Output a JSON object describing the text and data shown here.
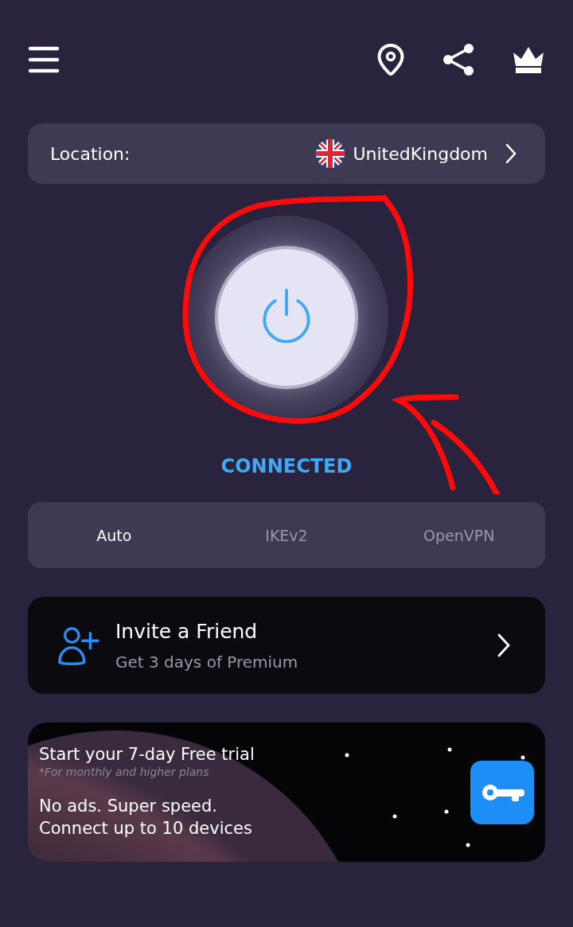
{
  "location": {
    "label": "Location:",
    "country": "UnitedKingdom"
  },
  "status": {
    "text": "CONNECTED",
    "connected": true
  },
  "protocols": [
    {
      "label": "Auto",
      "selected": true
    },
    {
      "label": "IKEv2",
      "selected": false
    },
    {
      "label": "OpenVPN",
      "selected": false
    }
  ],
  "invite": {
    "title": "Invite a Friend",
    "subtitle": "Get 3 days of Premium"
  },
  "promo": {
    "title": "Start your 7-day Free trial",
    "note": "*For monthly and higher plans",
    "lines": [
      "No ads. Super speed.",
      "Connect up to 10 devices"
    ]
  }
}
